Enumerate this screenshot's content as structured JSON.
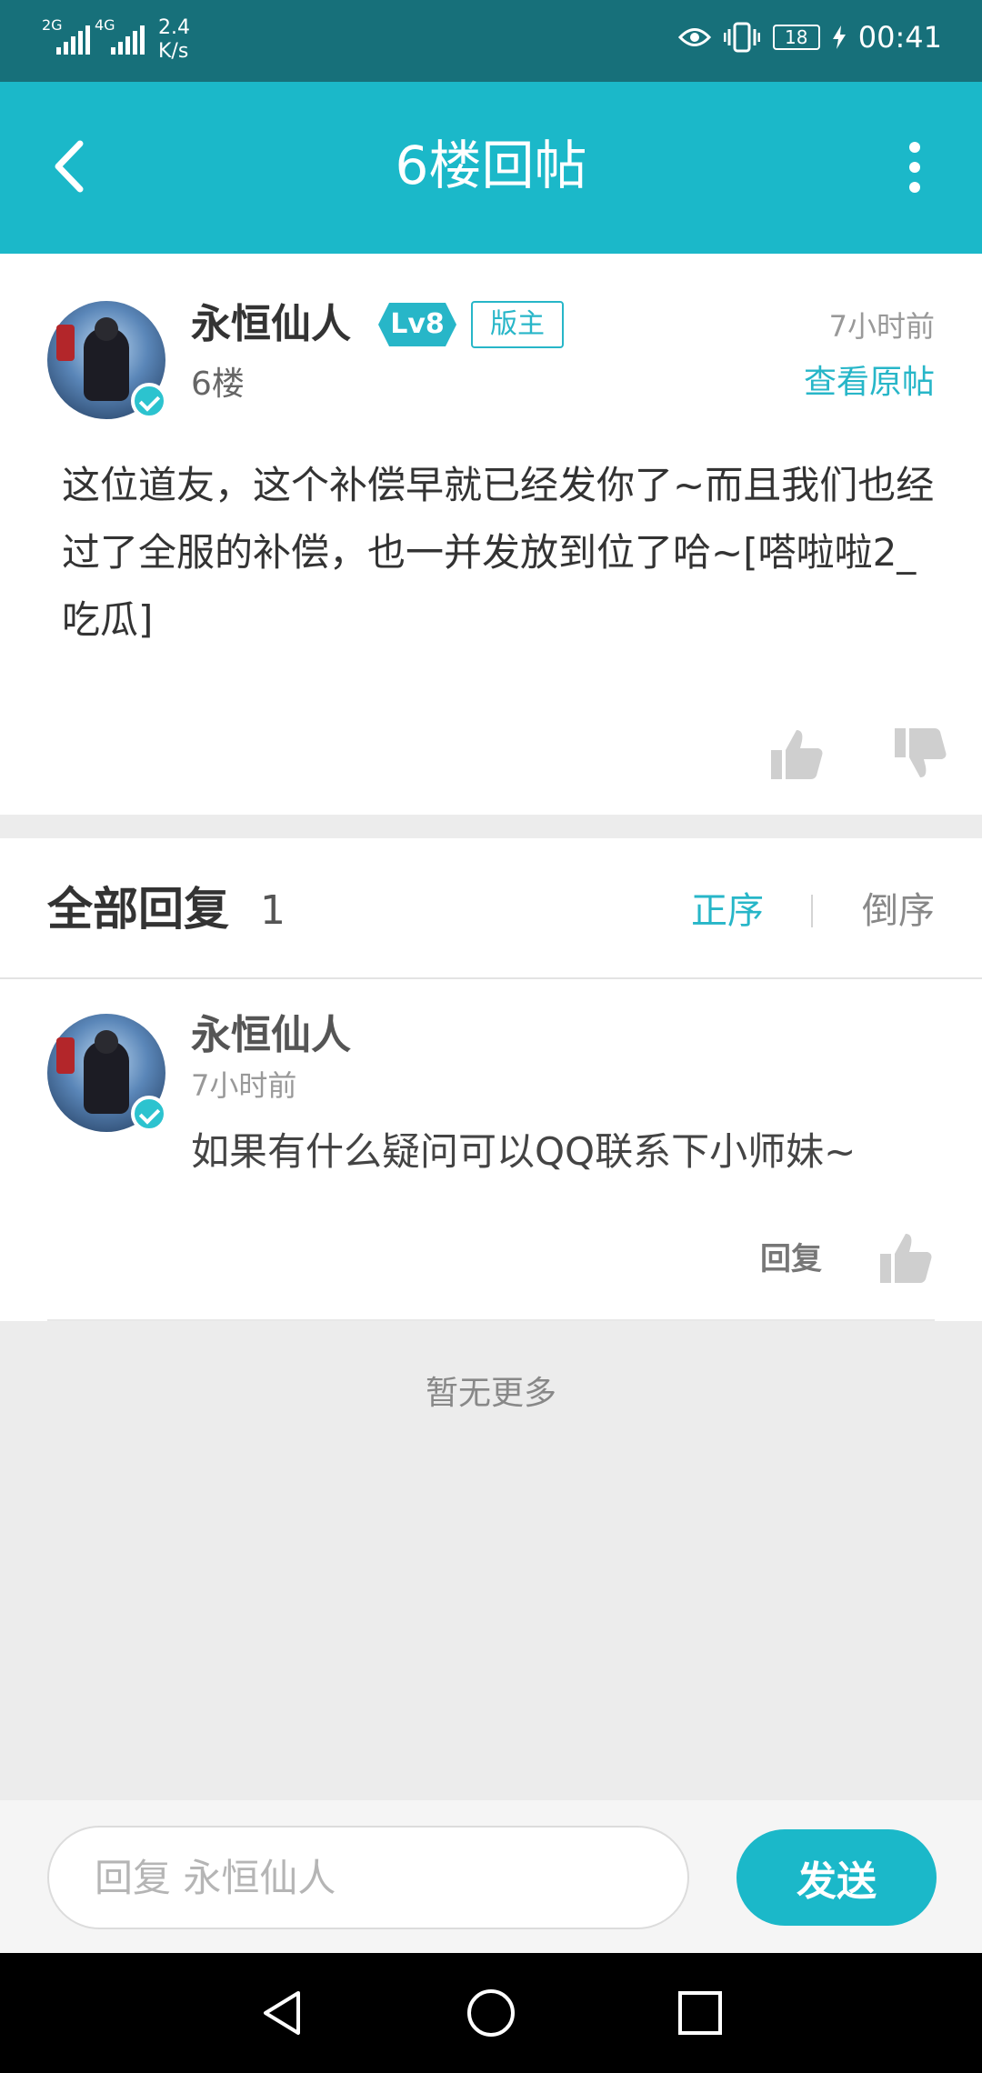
{
  "status_bar": {
    "sig1": "2G",
    "sig2": "4G",
    "speed_value": "2.4",
    "speed_unit": "K/s",
    "battery": "18",
    "time": "00:41",
    "icons": [
      "eye-icon",
      "vibrate-icon",
      "battery-icon",
      "charging-icon"
    ]
  },
  "header": {
    "title": "6楼回帖",
    "back_icon": "back-arrow-icon",
    "more_icon": "more-vertical-icon"
  },
  "post": {
    "username": "永恒仙人",
    "level": "Lv8",
    "role": "版主",
    "floor": "6楼",
    "time": "7小时前",
    "view_original": "查看原帖",
    "content": "这位道友，这个补偿早就已经发你了~而且我们也经过了全服的补偿，也一并发放到位了哈~[嗒啦啦2_吃瓜]"
  },
  "replies": {
    "title": "全部回复",
    "count": "1",
    "sort_asc": "正序",
    "sort_desc": "倒序",
    "items": [
      {
        "username": "永恒仙人",
        "time": "7小时前",
        "text": "如果有什么疑问可以QQ联系下小师妹~",
        "reply_label": "回复"
      }
    ],
    "no_more": "暂无更多"
  },
  "input_bar": {
    "placeholder": "回复 永恒仙人",
    "send_label": "发送"
  },
  "colors": {
    "accent": "#1bb8c9",
    "status_bar": "#17707a"
  }
}
